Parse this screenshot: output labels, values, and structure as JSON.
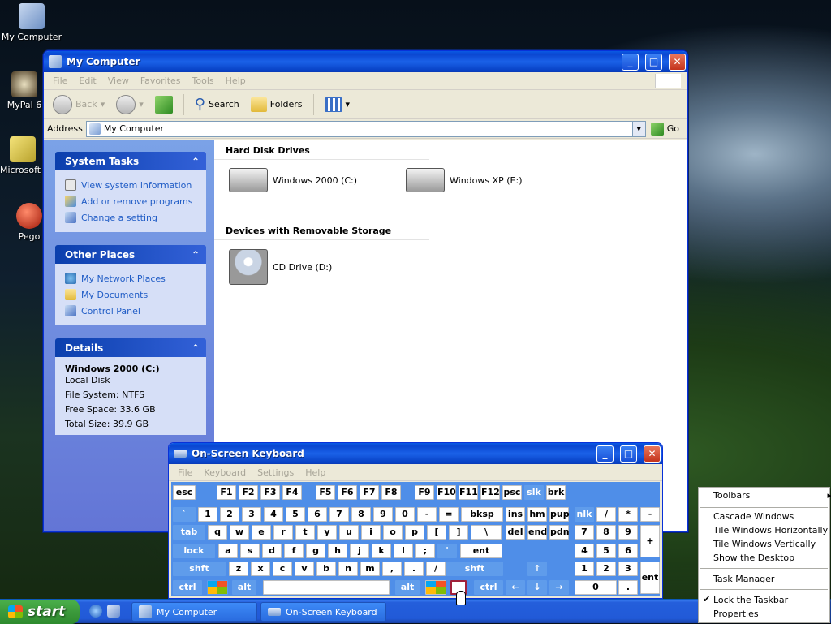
{
  "desktop": {
    "icons": [
      {
        "label": "My Computer"
      },
      {
        "label": "MyPal 6"
      },
      {
        "label": "Microsoft Outlook"
      },
      {
        "label": "Pego"
      }
    ]
  },
  "explorer": {
    "title": "My Computer",
    "menu": [
      "File",
      "Edit",
      "View",
      "Favorites",
      "Tools",
      "Help"
    ],
    "toolbar": {
      "back": "Back",
      "search": "Search",
      "folders": "Folders"
    },
    "address": {
      "label": "Address",
      "value": "My Computer",
      "go": "Go"
    },
    "system_tasks": {
      "title": "System Tasks",
      "items": [
        "View system information",
        "Add or remove programs",
        "Change a setting"
      ]
    },
    "other_places": {
      "title": "Other Places",
      "items": [
        "My Network Places",
        "My Documents",
        "Control Panel"
      ]
    },
    "details": {
      "title": "Details",
      "name": "Windows 2000 (C:)",
      "type": "Local Disk",
      "fs": "File System: NTFS",
      "free": "Free Space: 33.6 GB",
      "total": "Total Size: 39.9 GB"
    },
    "sections": {
      "hdd": "Hard Disk Drives",
      "removable": "Devices with Removable Storage"
    },
    "drives": [
      "Windows 2000 (C:)",
      "Windows XP (E:)",
      "CD Drive (D:)"
    ]
  },
  "osk": {
    "title": "On-Screen Keyboard",
    "menu": [
      "File",
      "Keyboard",
      "Settings",
      "Help"
    ],
    "keys": {
      "r1": [
        "esc",
        "F1",
        "F2",
        "F3",
        "F4",
        "F5",
        "F6",
        "F7",
        "F8",
        "F9",
        "F10",
        "F11",
        "F12",
        "psc",
        "slk",
        "brk"
      ],
      "r2": [
        "`",
        "1",
        "2",
        "3",
        "4",
        "5",
        "6",
        "7",
        "8",
        "9",
        "0",
        "-",
        "=",
        "bksp",
        "ins",
        "hm",
        "pup",
        "nlk",
        "/",
        "*",
        "-"
      ],
      "r3": [
        "tab",
        "q",
        "w",
        "e",
        "r",
        "t",
        "y",
        "u",
        "i",
        "o",
        "p",
        "[",
        "]",
        "\\",
        "del",
        "end",
        "pdn",
        "7",
        "8",
        "9",
        "+"
      ],
      "r4": [
        "lock",
        "a",
        "s",
        "d",
        "f",
        "g",
        "h",
        "j",
        "k",
        "l",
        ";",
        "'",
        "ent",
        "4",
        "5",
        "6"
      ],
      "r5": [
        "shft",
        "z",
        "x",
        "c",
        "v",
        "b",
        "n",
        "m",
        ",",
        ".",
        "/",
        "shft",
        "↑",
        "1",
        "2",
        "3",
        "ent"
      ],
      "r6": [
        "ctrl",
        "alt",
        "alt",
        "ctrl",
        "←",
        "↓",
        "→",
        "0",
        "."
      ]
    }
  },
  "taskbar": {
    "start": "start",
    "apps": [
      "My Computer",
      "On-Screen Keyboard"
    ]
  },
  "context_menu": {
    "items": [
      "Toolbars",
      "Cascade Windows",
      "Tile Windows Horizontally",
      "Tile Windows Vertically",
      "Show the Desktop",
      "Task Manager",
      "Lock the Taskbar",
      "Properties"
    ]
  }
}
